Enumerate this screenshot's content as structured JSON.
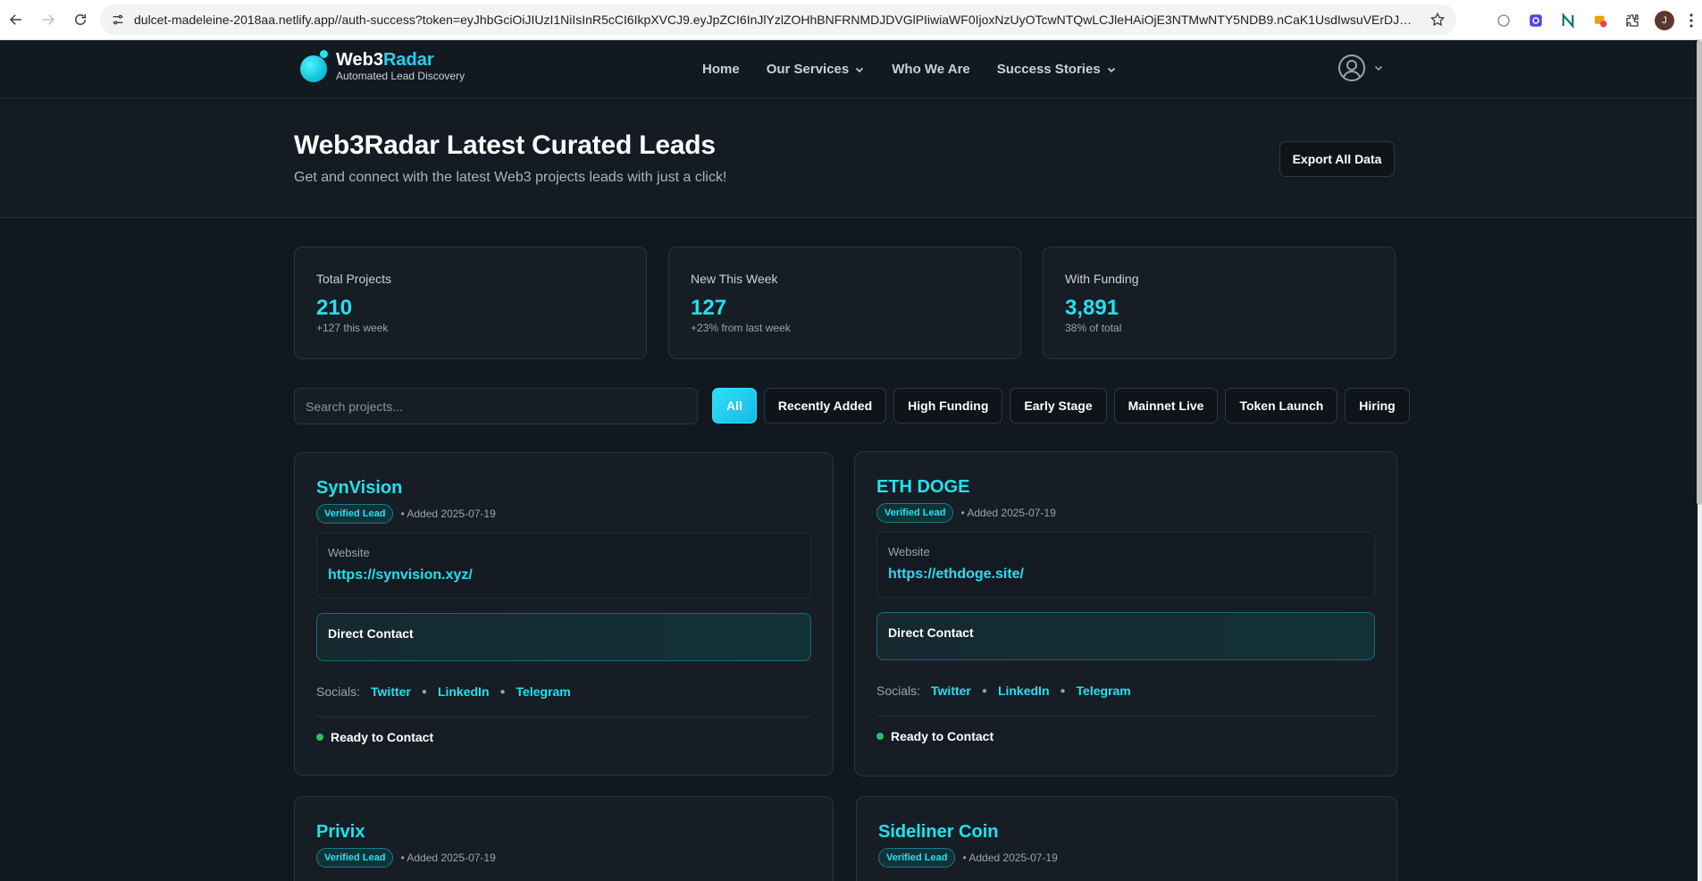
{
  "browser": {
    "url": "dulcet-madeleine-2018aa.netlify.app//auth-success?token=eyJhbGciOiJIUzI1NiIsInR5cCI6IkpXVCJ9.eyJpZCI6InJlYzlZOHhBNFRNMDJDVGlPIiwiaWF0IjoxNzUyOTcwNTQwLCJleHAiOjE3NTMwNTY5NDB9.nCaK1UsdIwsuVErDJRM6f-nWio...",
    "profile_initial": "J"
  },
  "header": {
    "logo_name_part1": "Web3",
    "logo_name_part2": "Radar",
    "logo_tagline": "Automated Lead Discovery",
    "nav": [
      {
        "label": "Home"
      },
      {
        "label": "Our Services"
      },
      {
        "label": "Who We Are"
      },
      {
        "label": "Success Stories"
      }
    ]
  },
  "hero": {
    "title": "Web3Radar Latest Curated Leads",
    "subtitle": "Get and connect with the latest Web3 projects leads with just a click!",
    "export_label": "Export All Data"
  },
  "stats": [
    {
      "label": "Total Projects",
      "value": "210",
      "sub": "+127 this week"
    },
    {
      "label": "New This Week",
      "value": "127",
      "sub": "+23% from last week"
    },
    {
      "label": "With Funding",
      "value": "3,891",
      "sub": "38% of total"
    }
  ],
  "filters": {
    "search_placeholder": "Search projects...",
    "chips": [
      "All",
      "Recently Added",
      "High Funding",
      "Early Stage",
      "Mainnet Live",
      "Token Launch",
      "Hiring"
    ],
    "active": "All"
  },
  "leads": [
    {
      "name": "SynVision",
      "badge": "Verified Lead",
      "added": "• Added 2025-07-19",
      "website_label": "Website",
      "website": "https://synvision.xyz/",
      "contact": "Direct Contact",
      "socials_label": "Socials:",
      "socials": [
        "Twitter",
        "LinkedIn",
        "Telegram"
      ],
      "status": "Ready to Contact"
    },
    {
      "name": "ETH DOGE",
      "badge": "Verified Lead",
      "added": "• Added 2025-07-19",
      "website_label": "Website",
      "website": "https://ethdoge.site/",
      "contact": "Direct Contact",
      "socials_label": "Socials:",
      "socials": [
        "Twitter",
        "LinkedIn",
        "Telegram"
      ],
      "status": "Ready to Contact"
    },
    {
      "name": "Privix",
      "badge": "Verified Lead",
      "added": "• Added 2025-07-19"
    },
    {
      "name": "Sideliner Coin",
      "badge": "Verified Lead",
      "added": "• Added 2025-07-19"
    }
  ],
  "colors": {
    "accent": "#22e1f0",
    "background": "#111820",
    "card": "#161d25",
    "status_green": "#22c55e"
  }
}
